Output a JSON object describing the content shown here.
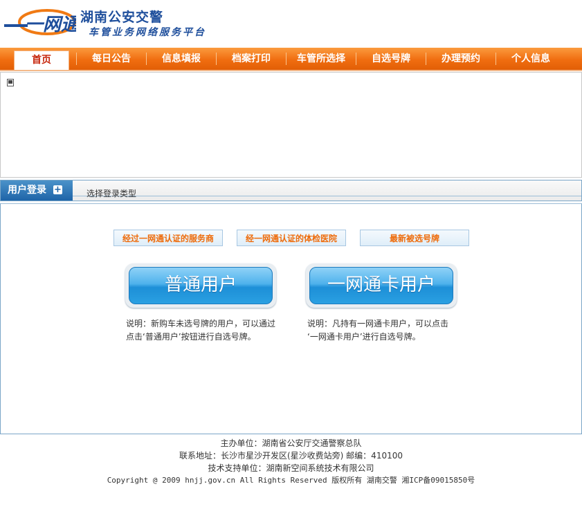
{
  "header": {
    "logo_text": "一网通",
    "title": "湖南公安交警",
    "subtitle": "车管业务网络服务平台"
  },
  "nav": {
    "items": [
      "首页",
      "每日公告",
      "信息填报",
      "档案打印",
      "车管所选择",
      "自选号牌",
      "办理预约",
      "个人信息"
    ],
    "active_index": 0
  },
  "login": {
    "tab_label": "用户登录",
    "tab_icon": "plus-icon",
    "choose_type": "选择登录类型",
    "links": [
      "经过一网通认证的服务商",
      "经一网通认证的体检医院",
      "最新被选号牌"
    ],
    "buttons": {
      "normal_user": "普通用户",
      "card_user": "一网通卡用户"
    },
    "desc_normal": [
      "说明：新购车未选号牌的用户，可以通过",
      "点击‘普通用户’按钮进行自选号牌。"
    ],
    "desc_card": [
      "说明：凡持有一网通卡用户，可以点击",
      "‘一网通卡用户’进行自选号牌。"
    ]
  },
  "footer": {
    "sponsor": "主办单位：湖南省公安厅交通警察总队",
    "address": "联系地址：长沙市星沙开发区(星沙收费站旁) 邮编：410100",
    "support": "技术支持单位：湖南新空间系统技术有限公司",
    "copyright": "Copyright @ 2009 hnjj.gov.cn All Rights Reserved 版权所有 湖南交警 湘ICP备09015850号"
  },
  "colors": {
    "nav_orange": "#f06d10",
    "brand_blue": "#1f4f9c",
    "link_orange": "#ee6b0a",
    "button_blue": "#1d8fd7"
  }
}
